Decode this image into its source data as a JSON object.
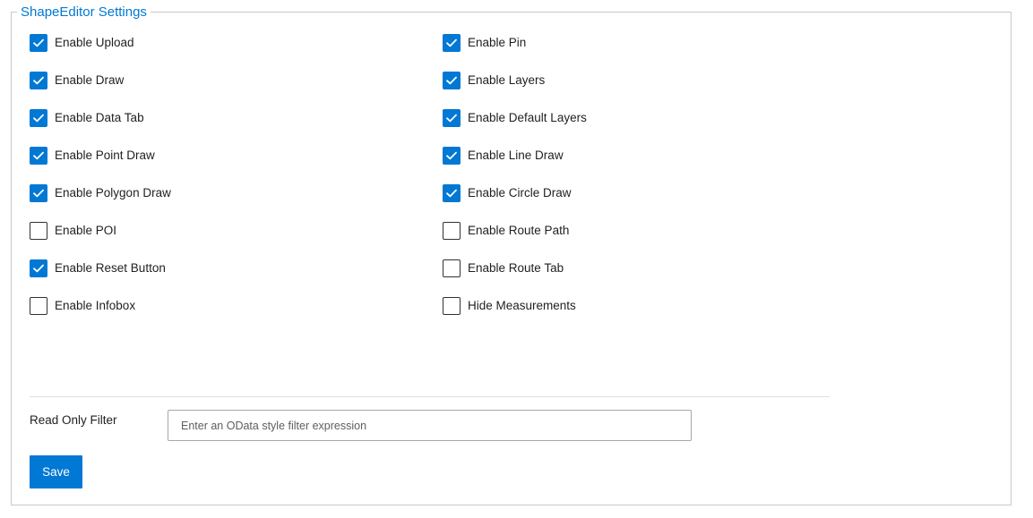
{
  "settings": {
    "title": "ShapeEditor Settings",
    "options_left": [
      {
        "label": "Enable Upload",
        "checked": true
      },
      {
        "label": "Enable Draw",
        "checked": true
      },
      {
        "label": "Enable Data Tab",
        "checked": true
      },
      {
        "label": "Enable Point Draw",
        "checked": true
      },
      {
        "label": "Enable Polygon Draw",
        "checked": true
      },
      {
        "label": "Enable POI",
        "checked": false
      },
      {
        "label": "Enable Reset Button",
        "checked": true
      },
      {
        "label": "Enable Infobox",
        "checked": false
      }
    ],
    "options_right": [
      {
        "label": "Enable Pin",
        "checked": true
      },
      {
        "label": "Enable Layers",
        "checked": true
      },
      {
        "label": "Enable Default Layers",
        "checked": true
      },
      {
        "label": "Enable Line Draw",
        "checked": true
      },
      {
        "label": "Enable Circle Draw",
        "checked": true
      },
      {
        "label": "Enable Route Path",
        "checked": false
      },
      {
        "label": "Enable Route Tab",
        "checked": false
      },
      {
        "label": "Hide Measurements",
        "checked": false
      }
    ],
    "filter": {
      "label": "Read Only Filter",
      "value": "",
      "placeholder": "Enter an OData style filter expression"
    },
    "save_label": "Save",
    "colors": {
      "accent": "#0078d4",
      "border": "#c8c8c8",
      "text": "#201f1e"
    }
  }
}
